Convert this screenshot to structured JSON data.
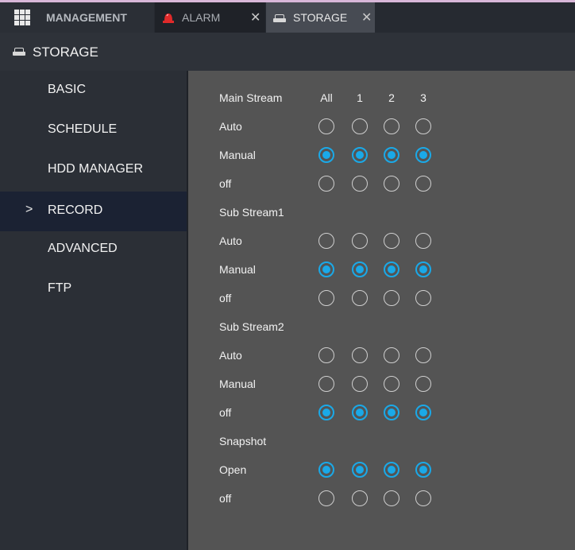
{
  "tabs": [
    {
      "label": "MANAGEMENT",
      "icon": "grid-icon"
    },
    {
      "label": "ALARM",
      "icon": "alarm-siren-icon",
      "closable": true
    },
    {
      "label": "STORAGE",
      "icon": "hdd-icon",
      "closable": true,
      "active": true
    }
  ],
  "close_glyph": "✕",
  "header": {
    "title": "STORAGE",
    "icon": "hdd-icon"
  },
  "sidebar": {
    "items": [
      {
        "label": "BASIC"
      },
      {
        "label": "SCHEDULE"
      },
      {
        "label": "HDD MANAGER"
      },
      {
        "label": "RECORD",
        "active": true
      },
      {
        "label": "ADVANCED"
      },
      {
        "label": "FTP"
      }
    ],
    "active_marker": ">"
  },
  "record": {
    "columns": [
      "All",
      "1",
      "2",
      "3"
    ],
    "groups": [
      {
        "title": "Main Stream",
        "options": [
          {
            "label": "Auto",
            "selected": [
              false,
              false,
              false,
              false
            ]
          },
          {
            "label": "Manual",
            "selected": [
              true,
              true,
              true,
              true
            ]
          },
          {
            "label": "off",
            "selected": [
              false,
              false,
              false,
              false
            ]
          }
        ]
      },
      {
        "title": "Sub Stream1",
        "options": [
          {
            "label": "Auto",
            "selected": [
              false,
              false,
              false,
              false
            ]
          },
          {
            "label": "Manual",
            "selected": [
              true,
              true,
              true,
              true
            ]
          },
          {
            "label": "off",
            "selected": [
              false,
              false,
              false,
              false
            ]
          }
        ]
      },
      {
        "title": "Sub Stream2",
        "options": [
          {
            "label": "Auto",
            "selected": [
              false,
              false,
              false,
              false
            ]
          },
          {
            "label": "Manual",
            "selected": [
              false,
              false,
              false,
              false
            ]
          },
          {
            "label": "off",
            "selected": [
              true,
              true,
              true,
              true
            ]
          }
        ]
      },
      {
        "title": "Snapshot",
        "options": [
          {
            "label": "Open",
            "selected": [
              true,
              true,
              true,
              true
            ]
          },
          {
            "label": "off",
            "selected": [
              false,
              false,
              false,
              false
            ]
          }
        ]
      }
    ]
  },
  "colors": {
    "accent": "#1aa9e8",
    "alarm": "#e02a2a"
  }
}
